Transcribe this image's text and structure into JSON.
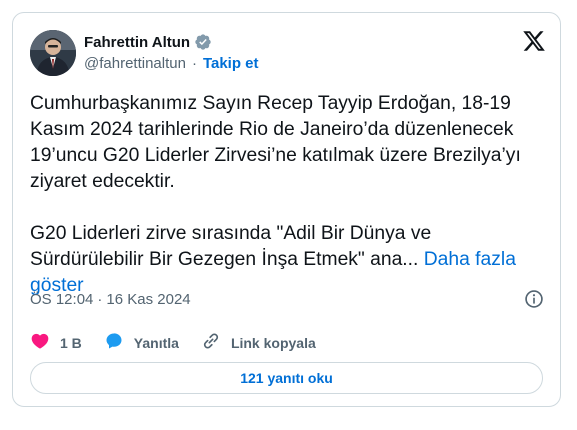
{
  "author": {
    "name": "Fahrettin Altun",
    "handle": "@fahrettinaltun",
    "separator": "·",
    "follow_label": "Takip et"
  },
  "post": {
    "paragraph1": "Cumhurbaşkanımız Sayın Recep Tayyip Erdoğan, 18-19 Kasım 2024 tarihlerinde Rio de Janeiro’da düzenlenecek 19’uncu G20 Liderler Zirvesi’ne katılmak üzere Brezilya’yı ziyaret edecektir.",
    "paragraph2": "G20 Liderleri zirve sırasında \"Adil Bir Dünya ve Sürdürülebilir Bir Gezegen İnşa Etmek\" ana...",
    "show_more": "Daha fazla göster"
  },
  "meta": {
    "time": "ÖS 12:04",
    "separator": "·",
    "date": "16 Kas 2024"
  },
  "actions": {
    "likes": "1 B",
    "reply_label": "Yanıtla",
    "copy_link_label": "Link kopyala"
  },
  "replies_button": "121 yanıtı oku",
  "colors": {
    "link_blue": "#006fd6",
    "heart_red": "#f91880",
    "reply_blue": "#1d9bf0",
    "secondary_text": "#536471",
    "border": "#cfd9de"
  },
  "icons": [
    "verified-badge-icon",
    "x-logo-icon",
    "info-icon",
    "heart-icon",
    "reply-bubble-icon",
    "link-icon"
  ]
}
